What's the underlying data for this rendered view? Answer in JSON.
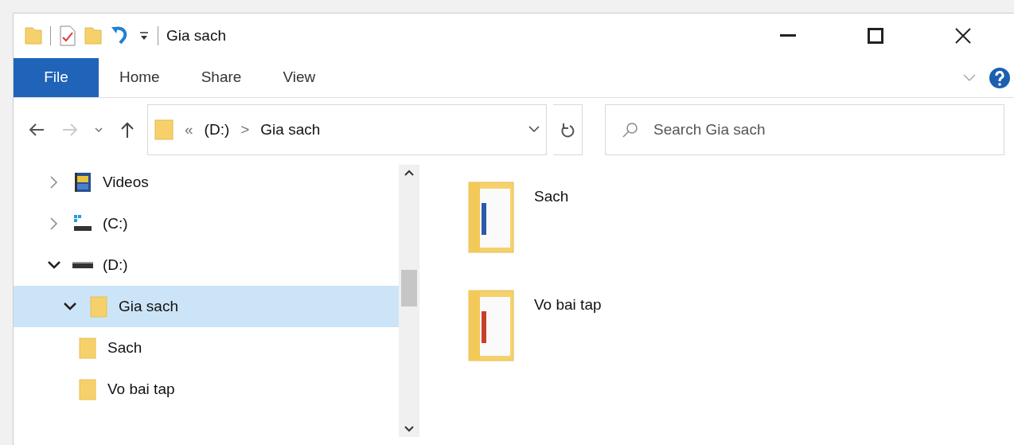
{
  "window": {
    "title": "Gia sach"
  },
  "ribbon_tabs": [
    {
      "label": "File",
      "kind": "file"
    },
    {
      "label": "Home",
      "kind": "tab"
    },
    {
      "label": "Share",
      "kind": "tab"
    },
    {
      "label": "View",
      "kind": "tab"
    }
  ],
  "address_bar": {
    "overflow": "«",
    "segments": [
      "(D:)",
      "Gia sach"
    ],
    "separator": ">"
  },
  "search": {
    "placeholder": "Search Gia sach"
  },
  "navigation_tree": [
    {
      "label": "Videos",
      "kind": "videos",
      "expanded": false,
      "selected": false
    },
    {
      "label": "(C:)",
      "kind": "system-drive",
      "expanded": false,
      "selected": false
    },
    {
      "label": "(D:)",
      "kind": "drive",
      "expanded": true,
      "selected": false,
      "children": [
        {
          "label": "Gia sach",
          "kind": "folder",
          "expanded": true,
          "selected": true,
          "children": [
            {
              "label": "Sach",
              "kind": "folder",
              "selected": false
            },
            {
              "label": "Vo bai tap",
              "kind": "folder",
              "selected": false
            }
          ]
        }
      ]
    }
  ],
  "items": [
    {
      "name": "Sach",
      "color": "#2b5aa8"
    },
    {
      "name": "Vo bai tap",
      "color": "#c8402a"
    }
  ]
}
